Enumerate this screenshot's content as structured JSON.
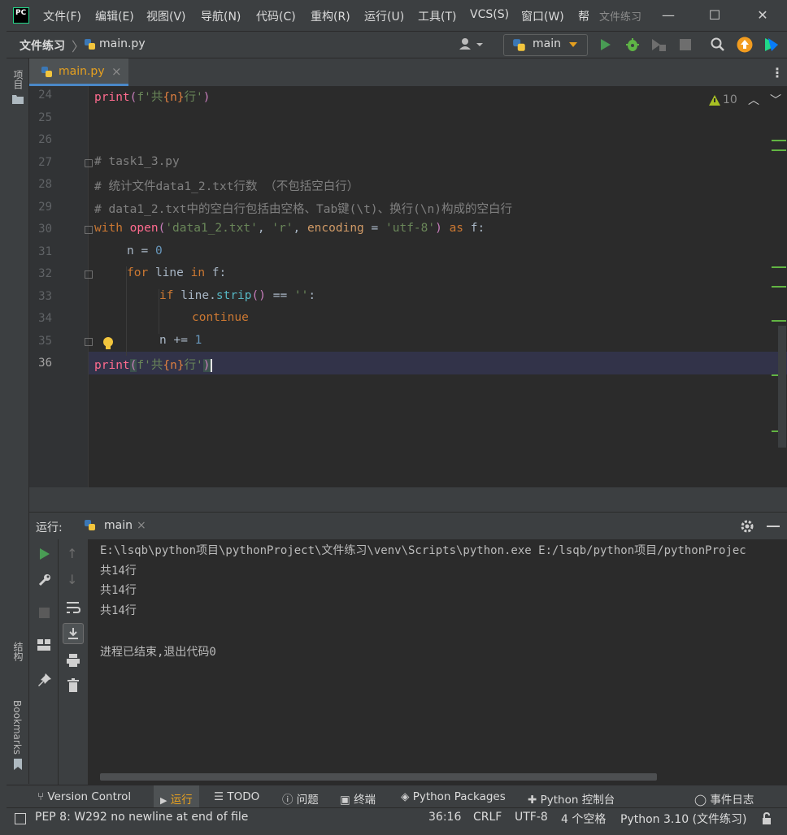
{
  "menu": [
    "文件(F)",
    "编辑(E)",
    "视图(V)",
    "导航(N)",
    "代码(C)",
    "重构(R)",
    "运行(U)",
    "工具(T)",
    "VCS(S)",
    "窗口(W)",
    "帮"
  ],
  "window_title": "文件练习",
  "app_logo": "PC",
  "breadcrumb": {
    "project": "文件练习",
    "file": "main.py"
  },
  "run_config": {
    "label": "main"
  },
  "left_strip": {
    "project": "项目",
    "structure": "结构",
    "bookmarks": "Bookmarks"
  },
  "editor_tab": {
    "label": "main.py",
    "close": "×"
  },
  "inspection": {
    "count": "10"
  },
  "lines": [
    "24",
    "25",
    "26",
    "27",
    "28",
    "29",
    "30",
    "31",
    "32",
    "33",
    "34",
    "35",
    "36"
  ],
  "code": {
    "l24": {
      "fn": "print",
      "a": "(",
      "b": "f'共",
      "c": "{n}",
      "d": "行'",
      ")": ")"
    },
    "l27": "# task1_3.py",
    "l28": "# 统计文件data1_2.txt行数 （不包括空白行）",
    "l29": "# data1_2.txt中的空白行包括由空格、Tab键(\\t)、换行(\\n)构成的空白行",
    "l30": {
      "kw": "with",
      "fn": "open",
      "p1": "(",
      "s1": "'data1_2.txt'",
      "c1": ", ",
      "s2": "'r'",
      "c2": ", ",
      "param": "encoding",
      "eq": " = ",
      "s3": "'utf-8'",
      "p2": ")",
      "as": "as",
      "var": "f:"
    },
    "l31": {
      "var": "n",
      "op": " = ",
      "num": "0"
    },
    "l32": {
      "kw": "for",
      "var": "line",
      "kw2": "in",
      "rest": "f:"
    },
    "l33": {
      "kw": "if",
      "var": "line.",
      "fn": "strip",
      "p": "()",
      "op": " == ",
      "s": "''",
      "c": ":"
    },
    "l34": "continue",
    "l35": {
      "var": "n",
      "op": " += ",
      "num": "1"
    },
    "l36": {
      "fn": "print",
      "a": "(",
      "b": "f'共",
      "c": "{n}",
      "d": "行'",
      ")": ")"
    }
  },
  "run_panel": {
    "label": "运行:",
    "tab": "main",
    "output": [
      "E:\\lsqb\\python项目\\pythonProject\\文件练习\\venv\\Scripts\\python.exe E:/lsqb/python项目/pythonProjec",
      "共14行",
      "共14行",
      "共14行",
      "",
      "进程已结束,退出代码0"
    ]
  },
  "bottom_tools": [
    "Version Control",
    "运行",
    "TODO",
    "问题",
    "终端",
    "Python Packages",
    "Python 控制台",
    "事件日志"
  ],
  "status": {
    "message": "PEP 8: W292 no newline at end of file",
    "position": "36:16",
    "line_sep": "CRLF",
    "encoding": "UTF-8",
    "indent": "4 个空格",
    "interpreter": "Python 3.10 (文件练习)"
  },
  "colors": {
    "accent": "#4a88c7",
    "run_green": "#499c54",
    "keyword": "#cc7832",
    "string": "#6a8759"
  }
}
